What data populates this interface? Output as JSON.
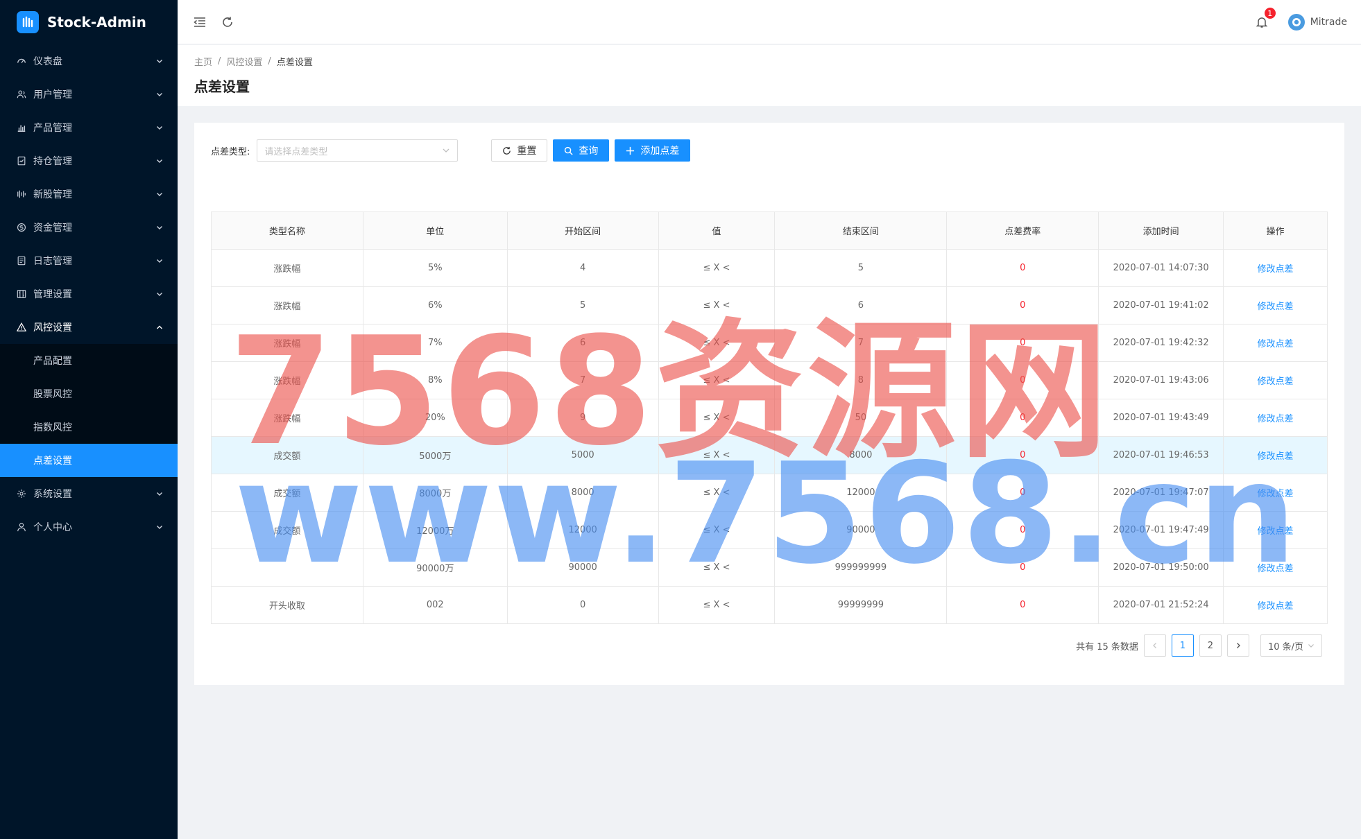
{
  "app": {
    "name": "Stock-Admin"
  },
  "sidebar": {
    "items": [
      {
        "label": "仪表盘",
        "icon": "dashboard-icon"
      },
      {
        "label": "用户管理",
        "icon": "users-icon"
      },
      {
        "label": "产品管理",
        "icon": "bar-chart-icon"
      },
      {
        "label": "持仓管理",
        "icon": "holdings-icon"
      },
      {
        "label": "新股管理",
        "icon": "ipo-icon"
      },
      {
        "label": "资金管理",
        "icon": "money-icon"
      },
      {
        "label": "日志管理",
        "icon": "log-icon"
      },
      {
        "label": "管理设置",
        "icon": "settings-grid-icon"
      },
      {
        "label": "风控设置",
        "icon": "warning-icon",
        "open": true
      },
      {
        "label": "系统设置",
        "icon": "gear-icon"
      },
      {
        "label": "个人中心",
        "icon": "user-icon"
      }
    ],
    "sub_items": [
      {
        "label": "产品配置"
      },
      {
        "label": "股票风控"
      },
      {
        "label": "指数风控"
      },
      {
        "label": "点差设置",
        "active": true
      }
    ]
  },
  "header": {
    "notification_count": "1",
    "username": "Mitrade"
  },
  "breadcrumb": [
    "主页",
    "风控设置",
    "点差设置"
  ],
  "page": {
    "title": "点差设置"
  },
  "filter": {
    "label": "点差类型:",
    "placeholder": "请选择点差类型",
    "reset_label": "重置",
    "query_label": "查询",
    "add_label": "添加点差"
  },
  "table": {
    "columns": [
      "类型名称",
      "单位",
      "开始区间",
      "值",
      "结束区间",
      "点差费率",
      "添加时间",
      "操作"
    ],
    "rows": [
      [
        "涨跌幅",
        "5%",
        "4",
        "≤ X <",
        "5",
        "0",
        "2020-07-01 14:07:30",
        "修改点差"
      ],
      [
        "涨跌幅",
        "6%",
        "5",
        "≤ X <",
        "6",
        "0",
        "2020-07-01 19:41:02",
        "修改点差"
      ],
      [
        "涨跌幅",
        "7%",
        "6",
        "≤ X <",
        "7",
        "0",
        "2020-07-01 19:42:32",
        "修改点差"
      ],
      [
        "涨跌幅",
        "8%",
        "7",
        "≤ X <",
        "8",
        "0",
        "2020-07-01 19:43:06",
        "修改点差"
      ],
      [
        "涨跌幅",
        "20%",
        "9",
        "≤ X <",
        "50",
        "0",
        "2020-07-01 19:43:49",
        "修改点差"
      ],
      [
        "成交额",
        "5000万",
        "5000",
        "≤ X <",
        "8000",
        "0",
        "2020-07-01 19:46:53",
        "修改点差"
      ],
      [
        "成交额",
        "8000万",
        "8000",
        "≤ X <",
        "12000",
        "0",
        "2020-07-01 19:47:07",
        "修改点差"
      ],
      [
        "成交额",
        "12000万",
        "12000",
        "≤ X <",
        "90000",
        "0",
        "2020-07-01 19:47:49",
        "修改点差"
      ],
      [
        "",
        "90000万",
        "90000",
        "≤ X <",
        "999999999",
        "0",
        "2020-07-01 19:50:00",
        "修改点差"
      ],
      [
        "开头收取",
        "002",
        "0",
        "≤ X <",
        "99999999",
        "0",
        "2020-07-01 21:52:24",
        "修改点差"
      ]
    ],
    "highlight_row": 5
  },
  "pagination": {
    "total_text": "共有 15 条数据",
    "pages": [
      "1",
      "2"
    ],
    "current": "1",
    "page_size": "10 条/页"
  },
  "watermark": {
    "line1": "7568资源网",
    "line2": "www.7568.cn"
  },
  "colors": {
    "sidebar_bg": "#001529",
    "primary": "#1890ff",
    "danger": "#f5222d"
  }
}
